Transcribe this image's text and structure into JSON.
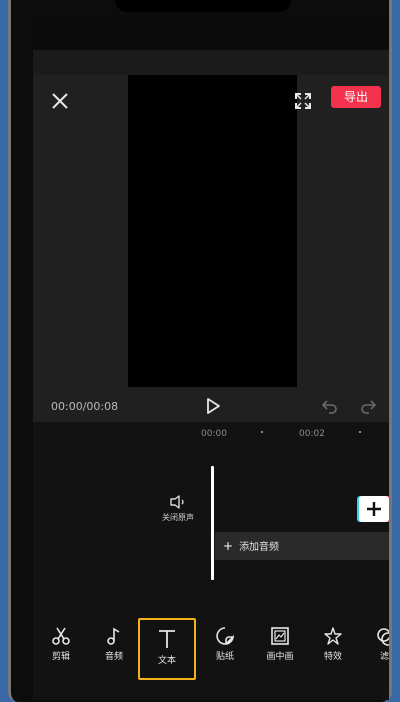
{
  "top_bar": {
    "export_label": "导出"
  },
  "player": {
    "time_readout": "00:00/00:08"
  },
  "timeline": {
    "ruler_labels": [
      "00:00",
      "00:02"
    ],
    "mute_label": "关闭原声",
    "add_audio_label": "添加音频"
  },
  "toolbar": {
    "items": [
      {
        "label": "剪辑",
        "icon": "scissors-icon"
      },
      {
        "label": "音频",
        "icon": "music-note-icon"
      },
      {
        "label": "文本",
        "icon": "text-icon"
      },
      {
        "label": "贴纸",
        "icon": "sticker-icon"
      },
      {
        "label": "画中画",
        "icon": "picture-in-picture-icon"
      },
      {
        "label": "特效",
        "icon": "effects-star-icon"
      },
      {
        "label": "滤",
        "icon": "filter-icon"
      }
    ],
    "active_index": 2
  },
  "colors": {
    "accent_export": "#f3334d",
    "active_outline": "#f5b21b",
    "background": "#161616"
  }
}
